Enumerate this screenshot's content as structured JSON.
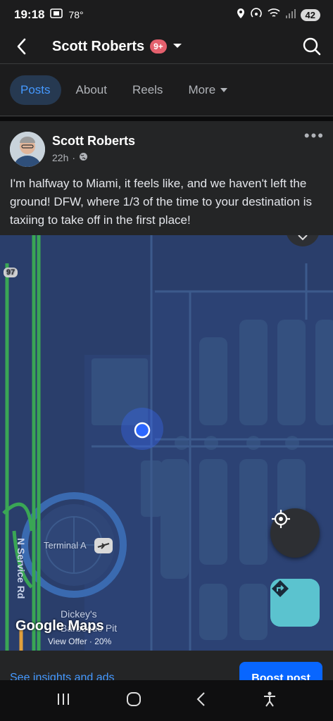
{
  "status_bar": {
    "time": "19:18",
    "temperature": "78°",
    "battery": "42"
  },
  "header": {
    "title": "Scott Roberts",
    "notification_badge": "9+"
  },
  "tabs": [
    {
      "label": "Posts",
      "active": true
    },
    {
      "label": "About",
      "active": false
    },
    {
      "label": "Reels",
      "active": false
    },
    {
      "label": "More",
      "active": false
    }
  ],
  "post": {
    "author": "Scott Roberts",
    "time": "22h",
    "privacy_icon": "globe-icon",
    "text": "I'm halfway to Miami, it feels like, and we haven't left the ground! DFW, where 1/3 of the time to your destination is taxiing to take off in the first place!"
  },
  "map": {
    "road_label": "N Service Rd",
    "route_shield": "97",
    "terminal_label": "Terminal A",
    "poi_label_line1": "Dickey's",
    "poi_label_line2": "Barbecue Pit",
    "attribution": "Google Maps",
    "offer": "View Offer · 20%"
  },
  "footer": {
    "insights_link": "See insights and ads",
    "boost_button": "Boost post"
  },
  "colors": {
    "accent": "#4599ff",
    "map_bg": "#2a3e6b",
    "traffic_green": "#3aa655",
    "directions_fab": "#5bc3cf"
  }
}
